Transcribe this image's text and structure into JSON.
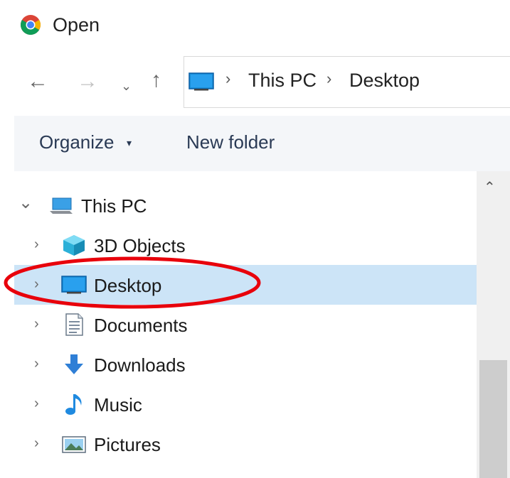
{
  "window": {
    "title": "Open",
    "app_icon": "chrome-icon"
  },
  "navigation": {
    "back": "←",
    "forward": "→",
    "recent": "⌄",
    "up": "↑"
  },
  "address": {
    "crumbs": [
      "This PC",
      "Desktop"
    ],
    "separator": "›",
    "icon": "desktop-icon"
  },
  "toolbar": {
    "organize_label": "Organize",
    "organize_caret": "▾",
    "new_folder_label": "New folder"
  },
  "tree": {
    "root": {
      "label": "This PC",
      "icon": "this-pc-icon",
      "expanded": true
    },
    "items": [
      {
        "label": "3D Objects",
        "icon": "3d-objects-icon"
      },
      {
        "label": "Desktop",
        "icon": "desktop-icon",
        "selected": true
      },
      {
        "label": "Documents",
        "icon": "documents-icon"
      },
      {
        "label": "Downloads",
        "icon": "downloads-icon"
      },
      {
        "label": "Music",
        "icon": "music-icon"
      },
      {
        "label": "Pictures",
        "icon": "pictures-icon"
      }
    ],
    "chevron_collapsed": "›",
    "chevron_expanded": "⌄"
  },
  "colors": {
    "selection": "#cce4f7",
    "annotation": "#e8000b",
    "toolbar_bg": "#f4f6f9"
  },
  "scrollbar": {
    "up_arrow": "⌃"
  }
}
